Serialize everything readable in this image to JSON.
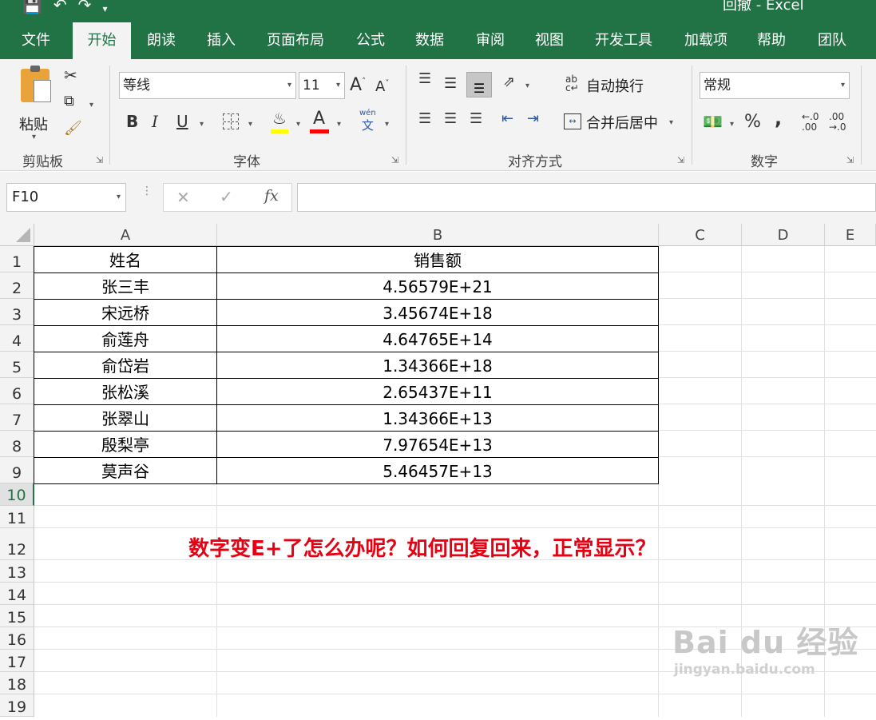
{
  "window": {
    "title": "回撤 - Excel"
  },
  "qat": {
    "save_icon": "save-icon",
    "undo_icon": "undo-icon",
    "redo_icon": "redo-icon",
    "customize_icon": "customize-qat-icon"
  },
  "tabs": [
    {
      "label": "文件"
    },
    {
      "label": "开始",
      "active": true
    },
    {
      "label": "朗读"
    },
    {
      "label": "插入"
    },
    {
      "label": "页面布局"
    },
    {
      "label": "公式"
    },
    {
      "label": "数据"
    },
    {
      "label": "审阅"
    },
    {
      "label": "视图"
    },
    {
      "label": "开发工具"
    },
    {
      "label": "加载项"
    },
    {
      "label": "帮助"
    },
    {
      "label": "团队"
    }
  ],
  "ribbon": {
    "clipboard": {
      "paste_label": "粘贴",
      "group_label": "剪贴板"
    },
    "font": {
      "font_name": "等线",
      "font_size": "11",
      "bold": "B",
      "italic": "I",
      "underline": "U",
      "group_label": "字体",
      "fill_color": "#ffff00",
      "font_color": "#ff0000",
      "phonetic_top": "wén",
      "phonetic_bottom": "文"
    },
    "alignment": {
      "wrap_label": "自动换行",
      "merge_label": "合并后居中",
      "group_label": "对齐方式"
    },
    "number": {
      "format": "常规",
      "percent": "%",
      "comma": ",",
      "inc_top": "←.0",
      "inc_bottom": ".00",
      "dec_top": ".00",
      "dec_bottom": "→.0",
      "group_label": "数字"
    }
  },
  "formula_bar": {
    "name_box": "F10",
    "cancel": "✕",
    "enter": "✓",
    "fx": "fx",
    "formula": ""
  },
  "sheet": {
    "columns": [
      "A",
      "B",
      "C",
      "D",
      "E"
    ],
    "rows": [
      "1",
      "2",
      "3",
      "4",
      "5",
      "6",
      "7",
      "8",
      "9",
      "10",
      "11",
      "12",
      "13",
      "14",
      "15",
      "16",
      "17",
      "18",
      "19"
    ],
    "table": {
      "headers": [
        "姓名",
        "销售额"
      ],
      "data": [
        [
          "张三丰",
          "4.56579E+21"
        ],
        [
          "宋远桥",
          "3.45674E+18"
        ],
        [
          "俞莲舟",
          "4.64765E+14"
        ],
        [
          "俞岱岩",
          "1.34366E+18"
        ],
        [
          "张松溪",
          "2.65437E+11"
        ],
        [
          "张翠山",
          "1.34366E+13"
        ],
        [
          "殷梨亭",
          "7.97654E+13"
        ],
        [
          "莫声谷",
          "5.46457E+13"
        ]
      ]
    },
    "annotation": "数字变E+了怎么办呢？如何回复回来，正常显示？",
    "selected_cell": "F10"
  },
  "watermark": {
    "main": "Bai du 经验",
    "sub": "jingyan.baidu.com"
  }
}
